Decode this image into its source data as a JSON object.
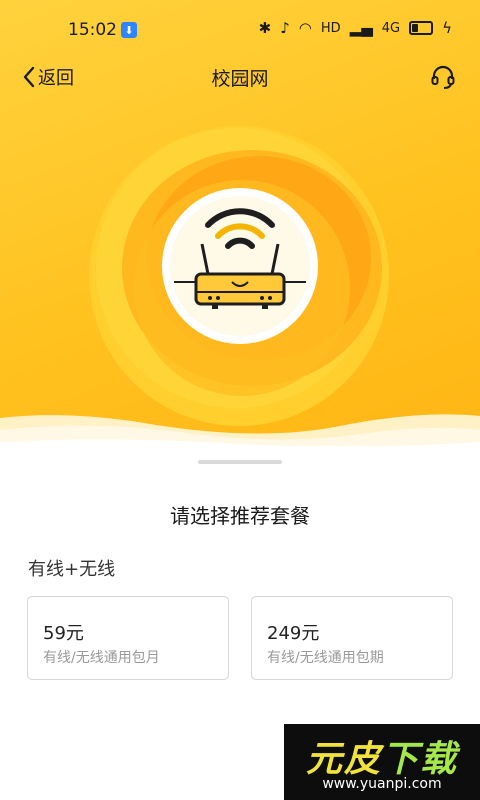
{
  "status_bar": {
    "time": "15:02",
    "network_label": "HD",
    "signal_4g": "4G"
  },
  "nav": {
    "back_label": "返回",
    "title": "校园网"
  },
  "sheet": {
    "title": "请选择推荐套餐",
    "section_label": "有线+无线",
    "plans": [
      {
        "price": "59元",
        "description": "有线/无线通用包月"
      },
      {
        "price": "249元",
        "description": "有线/无线通用包期"
      }
    ]
  },
  "watermark": {
    "text_1": "元皮",
    "text_2": "下载",
    "url": "www.yuanpi.com"
  },
  "colors": {
    "hero_yellow": "#ffc21f",
    "sun_orange": "#ff9a12",
    "card_border": "#d6d6d6"
  }
}
